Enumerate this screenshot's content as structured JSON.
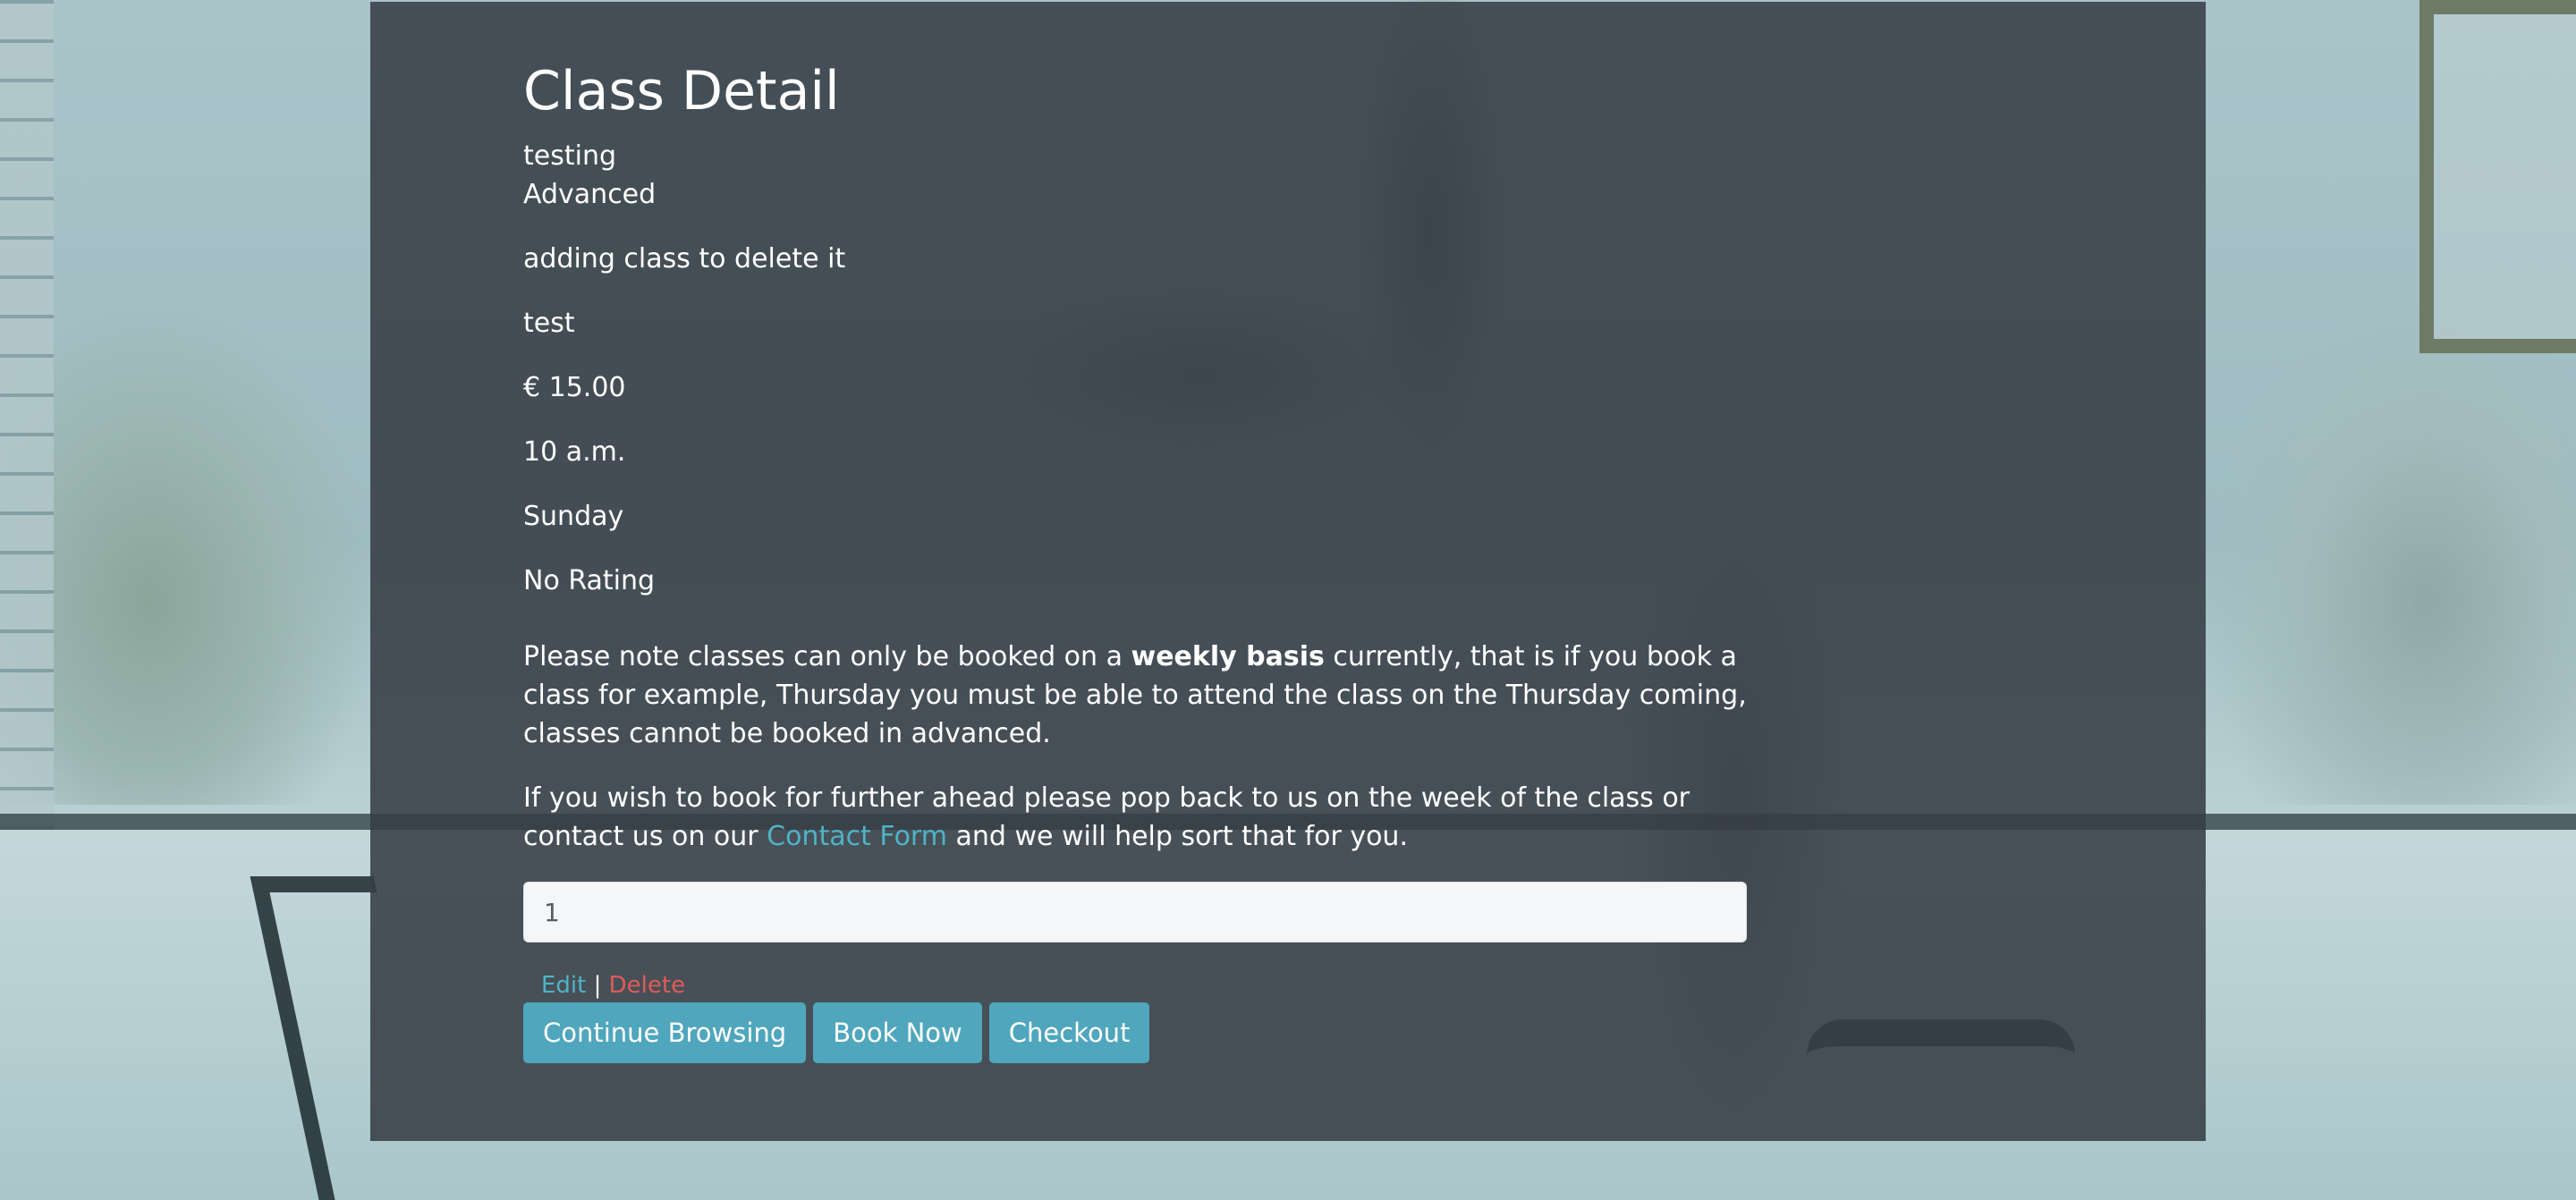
{
  "page": {
    "title": "Class Detail"
  },
  "class": {
    "name": "testing",
    "level": "Advanced",
    "description": "adding class to delete it",
    "instructor": "test",
    "price": "€ 15.00",
    "time": "10 a.m.",
    "day": "Sunday",
    "rating": "No Rating"
  },
  "notice": {
    "p1_before": "Please note classes can only be booked on a ",
    "p1_bold": "weekly basis",
    "p1_after": " currently, that is if you book a class for example, Thursday you must be able to attend the class on the Thursday coming, classes cannot be booked in advanced.",
    "p2_before": "If you wish to book for further ahead please pop back to us on the week of the class or contact us on our ",
    "p2_link": "Contact Form",
    "p2_after": " and we will help sort that for you."
  },
  "quantity": {
    "value": "1"
  },
  "admin": {
    "edit_label": "Edit",
    "separator": "|",
    "delete_label": "Delete"
  },
  "actions": {
    "continue_label": "Continue Browsing",
    "book_label": "Book Now",
    "checkout_label": "Checkout"
  },
  "colors": {
    "panel": "#373e46",
    "accent": "#4fa6bd",
    "link": "#4fb3c6",
    "delete": "#e05a5a"
  }
}
